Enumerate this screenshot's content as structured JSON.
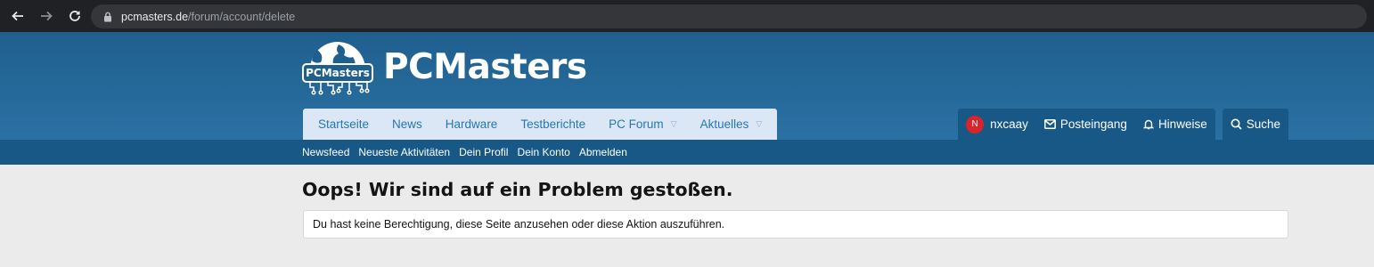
{
  "browser": {
    "url_host": "pcmasters.de",
    "url_path": "/forum/account/delete"
  },
  "site": {
    "logo_text": "PCMasters",
    "badge_text": "PCMasters",
    "accent_color": "#2577b1",
    "header_color": "#1f5f8e"
  },
  "nav": {
    "tabs": [
      {
        "label": "Startseite",
        "has_caret": false
      },
      {
        "label": "News",
        "has_caret": false
      },
      {
        "label": "Hardware",
        "has_caret": false
      },
      {
        "label": "Testberichte",
        "has_caret": false
      },
      {
        "label": "PC Forum",
        "has_caret": true
      },
      {
        "label": "Aktuelles",
        "has_caret": true
      }
    ],
    "user": {
      "avatar_letter": "N",
      "username": "nxcaay",
      "inbox_label": "Posteingang",
      "alerts_label": "Hinweise",
      "search_label": "Suche"
    }
  },
  "subnav": {
    "links": [
      "Newsfeed",
      "Neueste Aktivitäten",
      "Dein Profil",
      "Dein Konto",
      "Abmelden"
    ]
  },
  "main": {
    "title": "Oops! Wir sind auf ein Problem gestoßen.",
    "notice": "Du hast keine Berechtigung, diese Seite anzusehen oder diese Aktion auszuführen."
  }
}
